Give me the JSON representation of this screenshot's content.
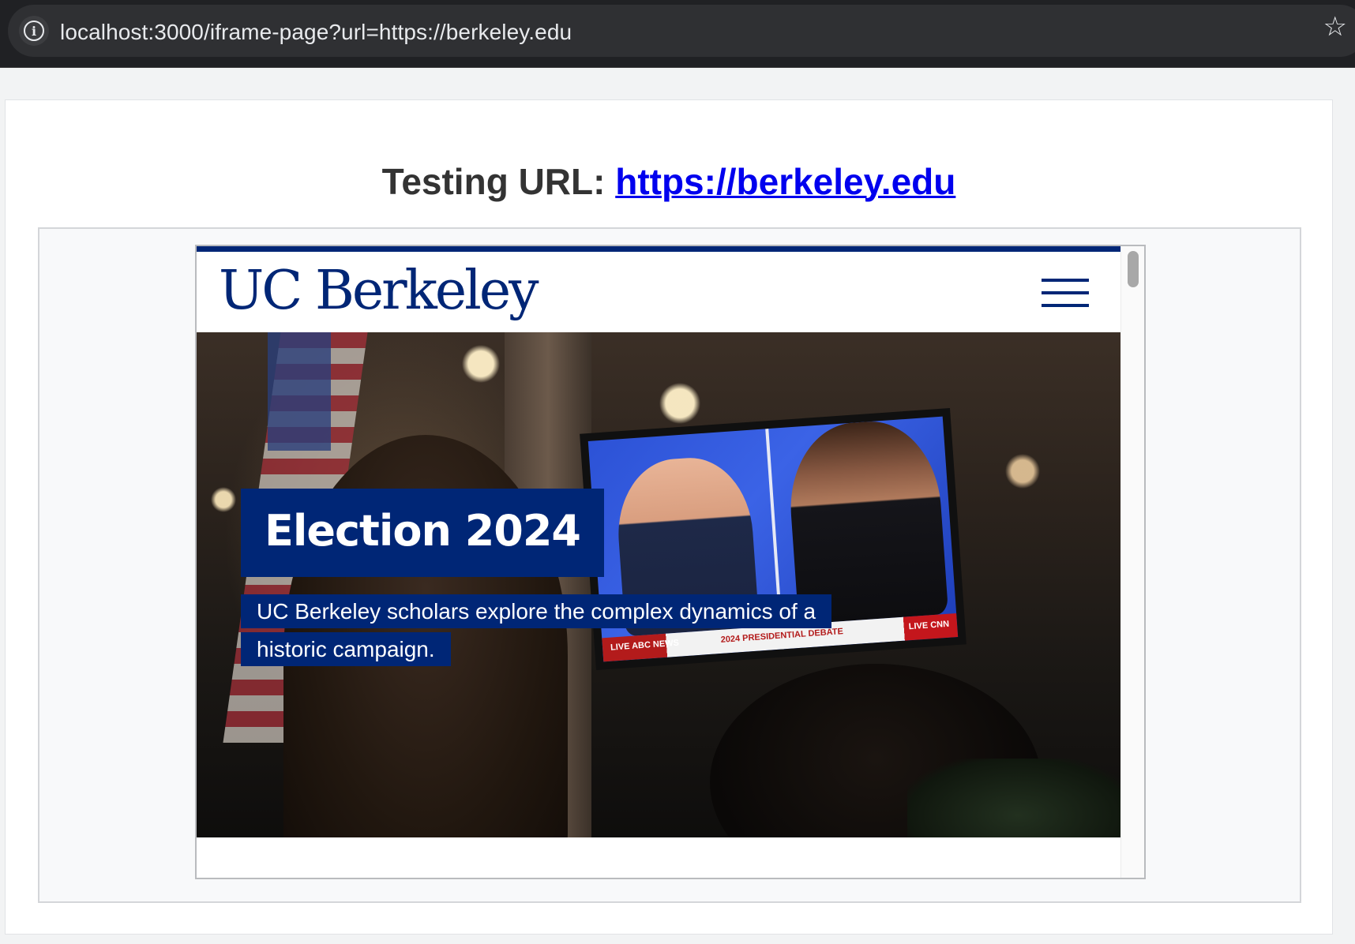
{
  "browser": {
    "url": "localhost:3000/iframe-page?url=https://berkeley.edu",
    "site_info_icon": "info-icon",
    "bookmark_icon": "star-icon"
  },
  "page": {
    "heading_prefix": "Testing URL: ",
    "heading_link": "https://berkeley.edu"
  },
  "embedded_site": {
    "logo": "UC Berkeley",
    "menu_icon": "hamburger-menu-icon",
    "hero": {
      "title": "Election 2024",
      "caption": "UC Berkeley scholars explore the complex dynamics of a historic campaign.",
      "tv_badges": {
        "news": "LIVE ABC NEWS",
        "debate": "2024 PRESIDENTIAL DEBATE",
        "cnn": "LIVE CNN"
      }
    },
    "colors": {
      "brand_blue": "#002676",
      "link_blue": "#0000ee"
    }
  }
}
